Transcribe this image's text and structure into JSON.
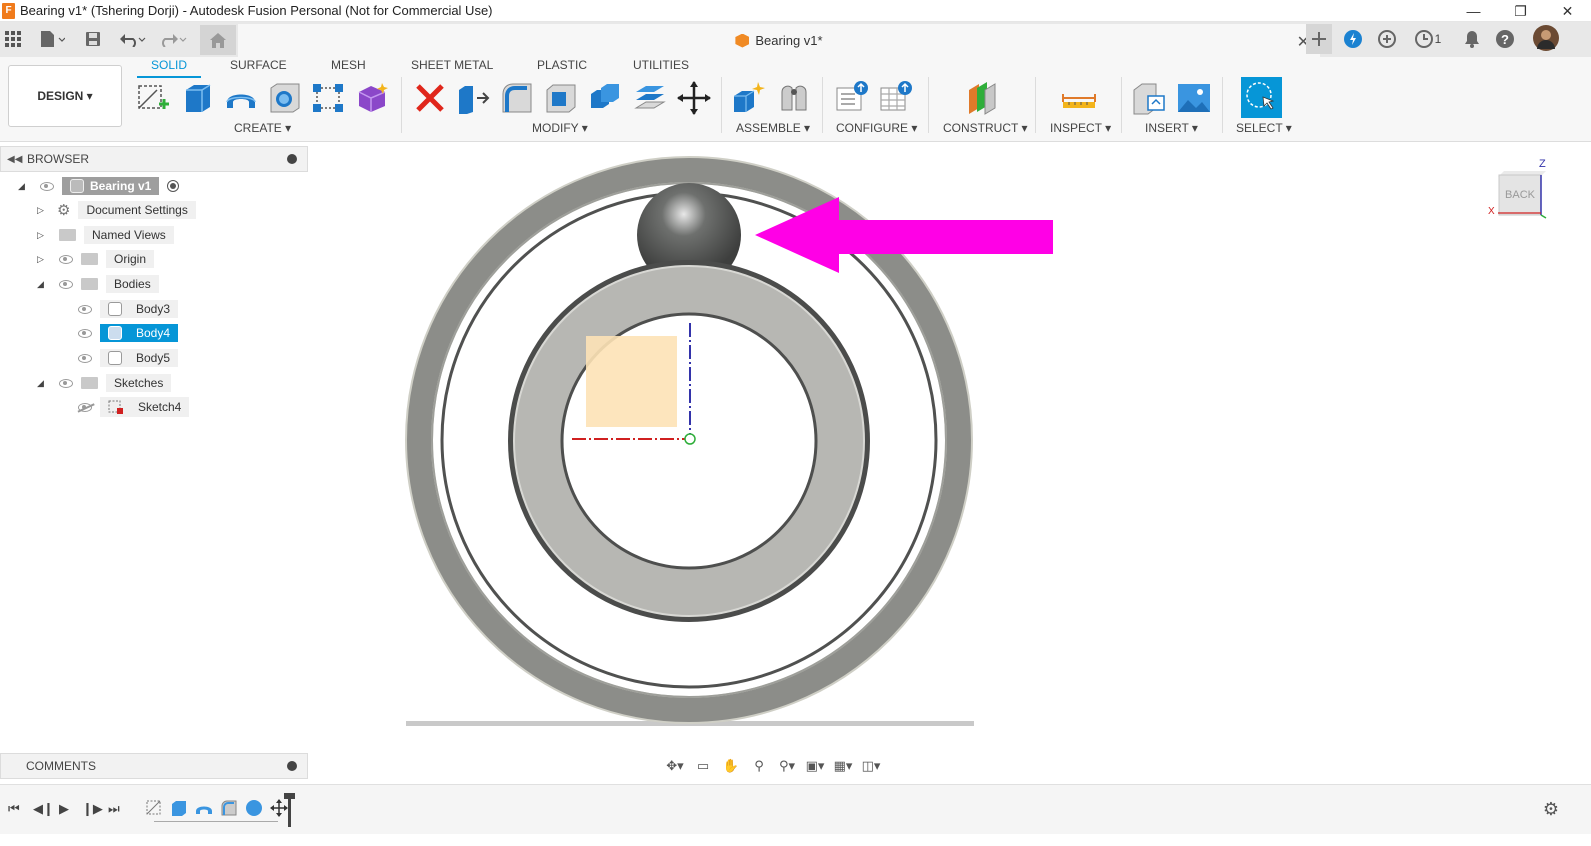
{
  "window": {
    "title": "Bearing v1* (Tshering Dorji) - Autodesk Fusion Personal (Not for Commercial Use)",
    "app_icon_letter": "F",
    "controls": [
      "—",
      "❐",
      "✕"
    ]
  },
  "doc_tab": {
    "name": "Bearing v1*",
    "notification_count": "1"
  },
  "workspace": {
    "label": "DESIGN ▾"
  },
  "tabs": [
    {
      "label": "SOLID",
      "active": true
    },
    {
      "label": "SURFACE"
    },
    {
      "label": "MESH"
    },
    {
      "label": "SHEET METAL"
    },
    {
      "label": "PLASTIC"
    },
    {
      "label": "UTILITIES"
    }
  ],
  "groups": {
    "create": "CREATE ▾",
    "modify": "MODIFY ▾",
    "assemble": "ASSEMBLE ▾",
    "configure": "CONFIGURE ▾",
    "construct": "CONSTRUCT ▾",
    "inspect": "INSPECT ▾",
    "insert": "INSERT ▾",
    "select": "SELECT ▾"
  },
  "browser": {
    "title": "BROWSER",
    "root": "Bearing v1",
    "items": {
      "document_settings": "Document Settings",
      "named_views": "Named Views",
      "origin": "Origin",
      "bodies": "Bodies",
      "body3": "Body3",
      "body4": "Body4",
      "body5": "Body5",
      "sketches": "Sketches",
      "sketch4": "Sketch4"
    }
  },
  "comments": {
    "title": "COMMENTS"
  },
  "viewcube": {
    "face": "BACK",
    "axis_z": "Z",
    "axis_x": "X"
  },
  "colors": {
    "accent": "#0696d7",
    "annotation_arrow": "#ff00e6",
    "ring_outer": "#8a8a85",
    "ring_inner": "#b9b9b6",
    "sketch_profile": "#fde2b6"
  }
}
